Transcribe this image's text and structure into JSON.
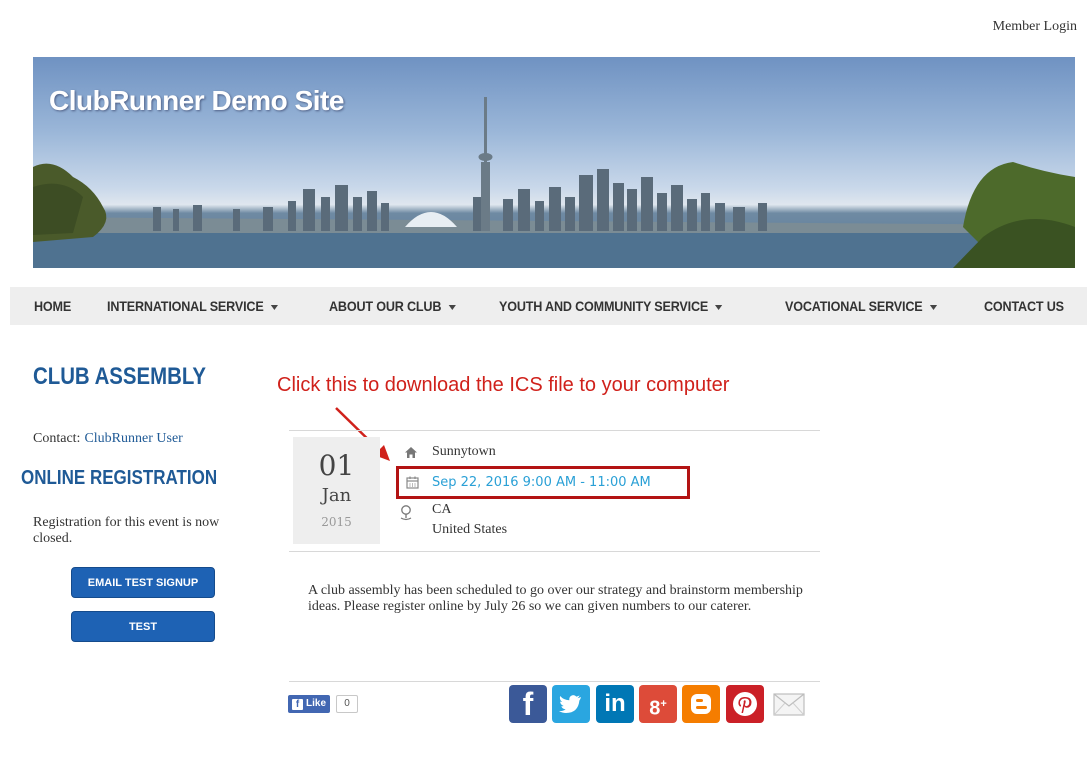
{
  "header": {
    "member_login": "Member Login",
    "site_title": "ClubRunner Demo Site"
  },
  "nav": {
    "items": [
      {
        "label": "HOME",
        "dropdown": false
      },
      {
        "label": "INTERNATIONAL SERVICE",
        "dropdown": true
      },
      {
        "label": "ABOUT OUR CLUB",
        "dropdown": true
      },
      {
        "label": "YOUTH AND COMMUNITY SERVICE",
        "dropdown": true
      },
      {
        "label": "VOCATIONAL SERVICE",
        "dropdown": true
      },
      {
        "label": "CONTACT US",
        "dropdown": false
      }
    ]
  },
  "sidebar": {
    "title": "CLUB ASSEMBLY",
    "contact_label": "Contact:",
    "contact_name": "ClubRunner User",
    "online_registration": "ONLINE REGISTRATION",
    "registration_status": "Registration for this event is now closed.",
    "buttons": [
      "EMAIL TEST SIGNUP",
      "TEST"
    ]
  },
  "annotation": "Click this to download the ICS file to your computer",
  "event": {
    "day": "01",
    "month": "Jan",
    "year": "2015",
    "location": "Sunnytown",
    "datetime": "Sep 22, 2016 9:00 AM - 11:00 AM",
    "region": "CA",
    "country": "United States",
    "description": "A club assembly has been scheduled to go over our strategy and brainstorm membership ideas. Please register online by July 26 so we can given numbers to our caterer."
  },
  "social": {
    "like_label": "Like",
    "like_count": "0",
    "share_icons": [
      "facebook-icon",
      "twitter-icon",
      "linkedin-icon",
      "google-plus-icon",
      "blogger-icon",
      "pinterest-icon",
      "email-icon"
    ]
  },
  "colors": {
    "brand_blue": "#1f5a96",
    "button_blue": "#1e62b4",
    "link_cyan": "#2aa0d6",
    "annotation_red": "#d0211b",
    "highlight_border": "#b31313"
  }
}
